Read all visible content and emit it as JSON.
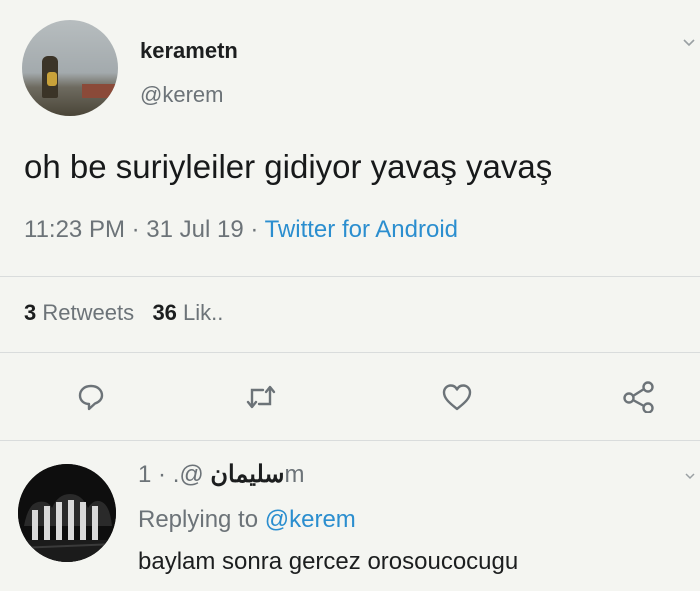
{
  "tweet": {
    "display_name": "kerametn",
    "handle": "@kerem",
    "text": "oh be suriyleiler gidiyor yavaş yavaş",
    "time": "11:23 PM",
    "sep1": " · ",
    "date": "31 Jul 19",
    "sep2": " · ",
    "source": "Twitter for Android",
    "retweets_count": "3",
    "retweets_label": "Retweets",
    "likes_count": "36",
    "likes_label": "Lik..",
    "avatar_icon": "profile-photo-icon"
  },
  "actions": [
    {
      "name": "reply-icon"
    },
    {
      "name": "retweet-icon"
    },
    {
      "name": "like-icon"
    },
    {
      "name": "share-icon"
    }
  ],
  "reply": {
    "display_name": "سليمان",
    "handle": "@.",
    "sep": " · ",
    "time": "1m",
    "replying_prefix": "Replying to ",
    "replying_to": "@kerem",
    "text": "baylam sonra gercez orosoucocugu"
  },
  "colors": {
    "background": "#f4f5f1",
    "link": "#2b8ecf",
    "secondary_text": "#6c7378"
  }
}
